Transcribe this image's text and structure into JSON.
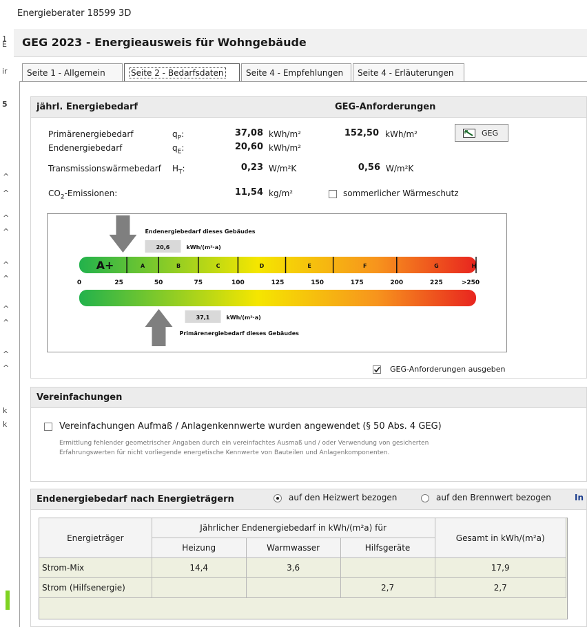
{
  "window": {
    "title": "Energieberater 18599 3D"
  },
  "header": {
    "title": "GEG 2023 - Energieausweis für Wohngebäude"
  },
  "tabs": [
    {
      "label": "Seite 1 - Allgemein"
    },
    {
      "label": "Seite 2 - Bedarfsdaten"
    },
    {
      "label": "Seite 4 - Empfehlungen"
    },
    {
      "label": "Seite 4 - Erläuterungen"
    }
  ],
  "bedarf": {
    "section_title": "jährl. Energiebedarf",
    "geg_title": "GEG-Anforderungen",
    "geg_button": "GEG",
    "rows": {
      "primaer": {
        "label": "Primärenergiebedarf",
        "symbol": "qP",
        "sym_prefix": "q",
        "sym_sub": "P",
        "value": "37,08",
        "unit": "kWh/m²",
        "geg_value": "152,50",
        "geg_unit": "kWh/m²"
      },
      "end": {
        "label": "Endenergiebedarf",
        "sym_prefix": "q",
        "sym_sub": "E",
        "value": "20,60",
        "unit": "kWh/m²"
      },
      "trans": {
        "label": "Transmissionswärmebedarf",
        "sym_prefix": "H",
        "sym_sub": "T",
        "value": "0,23",
        "unit": "W/m²K",
        "geg_value": "0,56",
        "geg_unit": "W/m²K"
      },
      "co2": {
        "label_prefix": "CO",
        "label_sub": "2",
        "label_suffix": "-Emissionen:",
        "value": "11,54",
        "unit": "kg/m²"
      }
    },
    "sommer_label": "sommerlicher Wärmeschutz",
    "geg_output_label": "GEG-Anforderungen ausgeben"
  },
  "scale": {
    "end_caption": "Endenergiebedarf dieses Gebäudes",
    "end_value": "20,6",
    "end_unit": "kWh/(m²·a)",
    "end_marker_value": 20.6,
    "primaer_caption": "Primärenergiebedarf dieses Gebäudes",
    "primaer_value": "37,1",
    "primaer_unit": "kWh/(m²·a)",
    "primaer_marker_value": 37.1,
    "classes": [
      "A+",
      "A",
      "B",
      "C",
      "D",
      "E",
      "F",
      "G",
      "H"
    ],
    "class_bounds": [
      0,
      30,
      50,
      75,
      100,
      130,
      160,
      200,
      250,
      275
    ],
    "ticks": [
      "0",
      "25",
      "50",
      "75",
      "100",
      "125",
      "150",
      "175",
      "200",
      "225",
      ">250"
    ],
    "colors": {
      "green": "#22b24c",
      "yellow": "#f5e600",
      "orange": "#f7941d",
      "red": "#e8251f"
    }
  },
  "vereinfachungen": {
    "title": "Vereinfachungen",
    "checkbox_label": "Vereinfachungen Aufmaß / Anlagenkennwerte wurden angewendet (§ 50 Abs. 4 GEG)",
    "desc_line1": "Ermittlung fehlender geometrischer Angaben durch ein vereinfachtes Ausmaß und / oder Verwendung von gesicherten",
    "desc_line2": "Erfahrungswerten für nicht vorliegende energetische Kennwerte von Bauteilen und Anlagenkomponenten."
  },
  "traeger": {
    "title": "Endenergiebedarf nach Energieträgern",
    "radio_heizwert": "auf den Heizwert bezogen",
    "radio_brennwert": "auf den Brennwert bezogen",
    "info_link": "In",
    "table": {
      "col_energietraeger": "Energieträger",
      "col_group": "Jährlicher Endenergiebedarf in kWh/(m²a) für",
      "col_heizung": "Heizung",
      "col_warmwasser": "Warmwasser",
      "col_hilfsgeraete": "Hilfsgeräte",
      "col_gesamt": "Gesamt in kWh/(m²a)",
      "rows": [
        {
          "name": "Strom-Mix",
          "heizung": "14,4",
          "warmwasser": "3,6",
          "hilfsgeraete": "",
          "gesamt": "17,9"
        },
        {
          "name": "Strom (Hilfsenergie)",
          "heizung": "",
          "warmwasser": "",
          "hilfsgeraete": "2,7",
          "gesamt": "2,7"
        }
      ]
    }
  }
}
